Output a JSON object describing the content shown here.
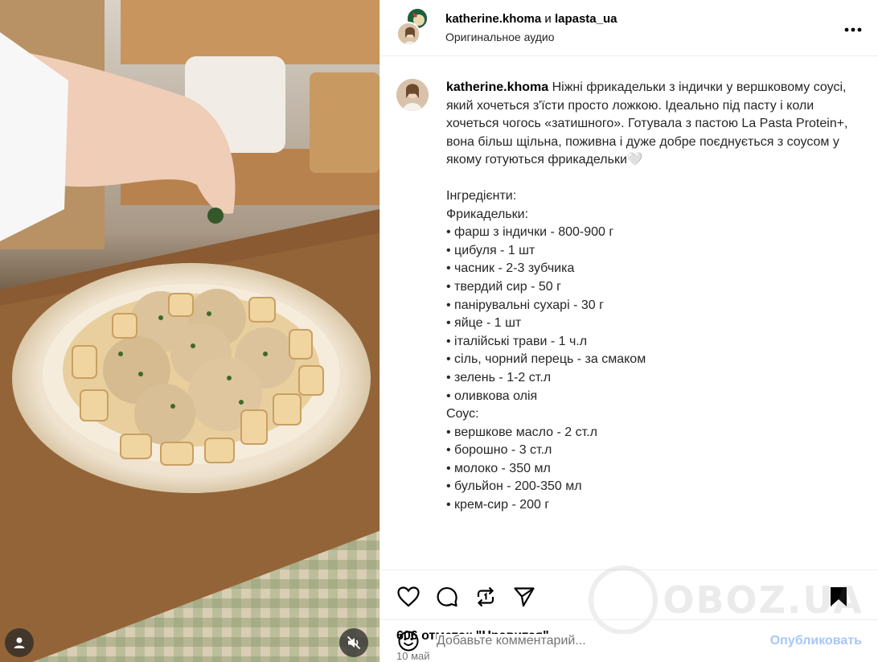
{
  "header": {
    "author": "katherine.khoma",
    "conjunction": "и",
    "coauthor": "lapasta_ua",
    "audio": "Оригинальное аудио",
    "more_icon": "more-horizontal-icon"
  },
  "caption": {
    "username": "katherine.khoma",
    "intro": "Ніжні фрикадельки з індички у вершковому соусі, який хочеться з'їсти просто ложкою. Ідеально під пасту і коли хочеться чогось «затишного». Готувала з пастою La Pasta Protein+, вона більш щільна, поживна і дуже добре поєднується з соусом у якому готуються фрикадельки🤍",
    "lines": [
      "Інгредієнти:",
      "Фрикадельки:",
      "• фарш з індички - 800-900 г",
      "• цибуля - 1 шт",
      "• часник - 2-3 зубчика",
      "• твердий сир - 50 г",
      "• панірувальні сухарі - 30 г",
      "• яйце - 1 шт",
      "• італійські трави - 1 ч.л",
      "• сіль, чорний перець - за смаком",
      "• зелень - 1-2 ст.л",
      "• оливкова олія",
      "Соус:",
      "• вершкове масло - 2 ст.л",
      "• борошно - 3 ст.л",
      "• молоко - 350 мл",
      "• бульйон - 200-350 мл",
      "• крем-сир - 200 г"
    ]
  },
  "actions": {
    "icons": [
      "heart-icon",
      "comment-icon",
      "repost-icon",
      "share-icon",
      "bookmark-icon"
    ]
  },
  "likes": "606 отметок \"Нравится\"",
  "date": "10 май",
  "comment": {
    "placeholder": "Добавьте комментарий...",
    "publish": "Опубликовать"
  },
  "watermark": "OBOZ.UA",
  "colors": {
    "publish": "#a7c7f3",
    "muted": "#737373",
    "border": "#efefef"
  }
}
